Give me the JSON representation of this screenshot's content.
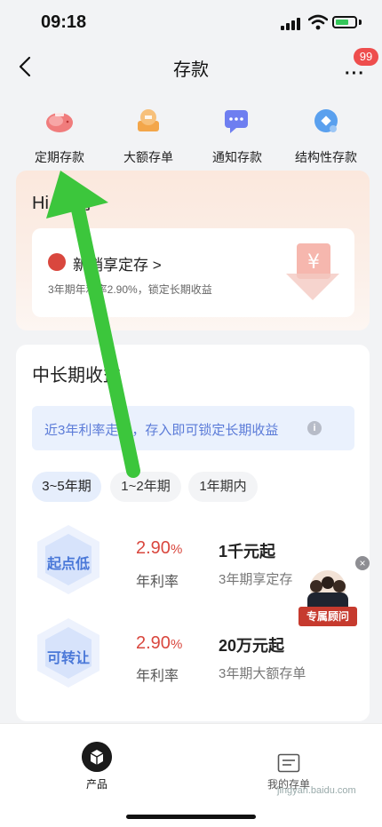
{
  "status_bar": {
    "time": "09:18"
  },
  "nav": {
    "title": "存款",
    "more_label": "···",
    "badge": "99"
  },
  "categories": [
    {
      "label": "定期存款",
      "icon": "piggy-bank-icon",
      "color": "#f07c7c"
    },
    {
      "label": "大额存单",
      "icon": "coin-stack-icon",
      "color": "#f3a64a"
    },
    {
      "label": "通知存款",
      "icon": "message-icon",
      "color": "#6e7ef0"
    },
    {
      "label": "结构性存款",
      "icon": "blue-coin-icon",
      "color": "#5aa0ee"
    }
  ],
  "greeting": {
    "text": "Hi,   午好~",
    "promo_title": "新销享定存 >",
    "promo_desc": "3年期年利率2.90%，锁定长期收益",
    "promo_art_glyph": "¥"
  },
  "section": {
    "title": "中长期收益",
    "tip": "近3年利率走势，存入即可锁定长期收益",
    "info_icon": "i",
    "tabs": [
      {
        "label": "3~5年期",
        "active": true
      },
      {
        "label": "1~2年期",
        "active": false
      },
      {
        "label": "1年期内",
        "active": false
      }
    ],
    "products": [
      {
        "badge": "起点低",
        "rate": "2.90",
        "rate_unit": "%",
        "rate_label": "年利率",
        "amount": "1千元起",
        "amount_sub": "3年期享定存"
      },
      {
        "badge": "可转让",
        "rate": "2.90",
        "rate_unit": "%",
        "rate_label": "年利率",
        "amount": "20万元起",
        "amount_sub": "3年期大额存单"
      }
    ]
  },
  "advisor": {
    "label": "专属顾问",
    "close": "×"
  },
  "bottom_nav": {
    "product_label": "产品",
    "mine_label": "我的存单",
    "watermark": "jingyan.baidu.com"
  },
  "colors": {
    "accent_red": "#d9473e",
    "accent_blue": "#4a78d8",
    "arrow_green": "#3cc63c"
  }
}
